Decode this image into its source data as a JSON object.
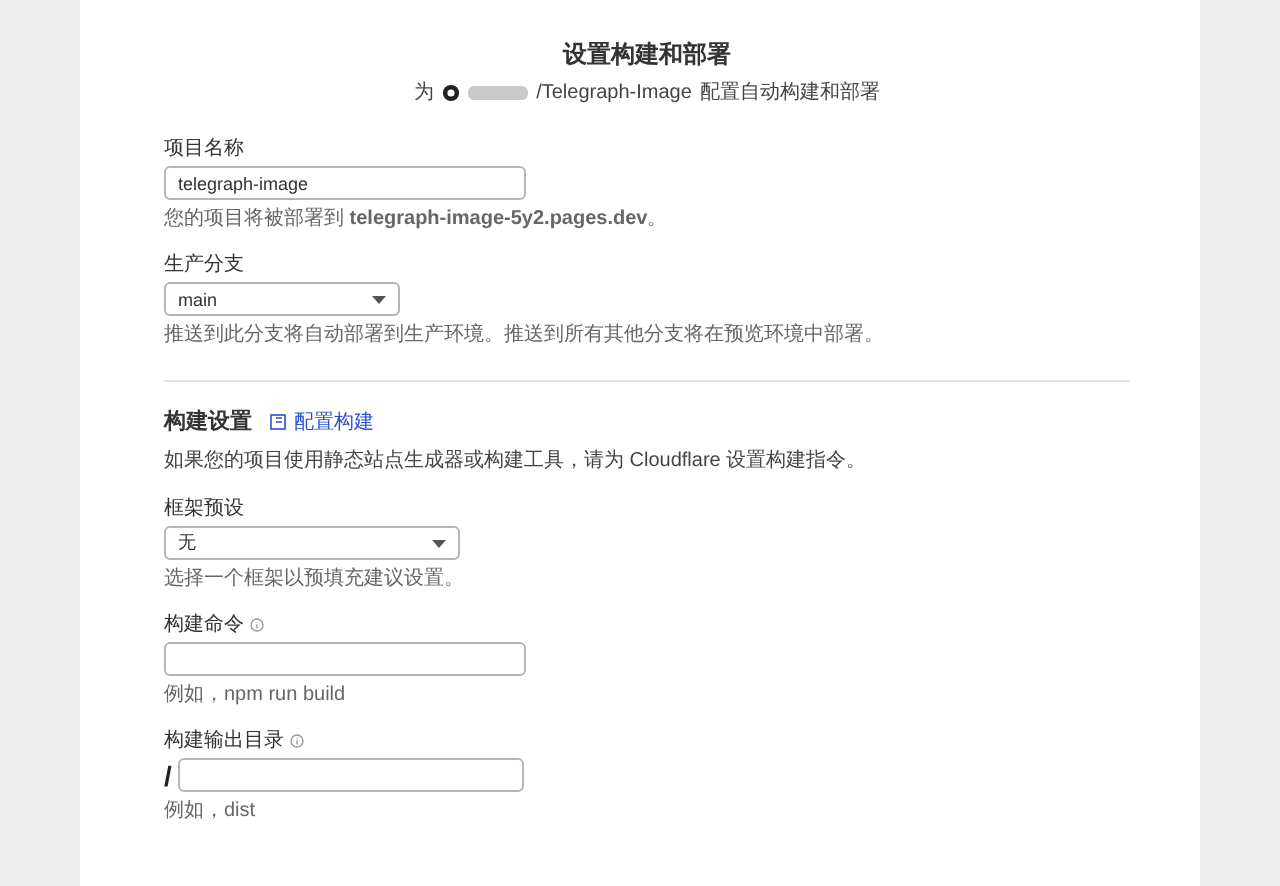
{
  "header": {
    "title": "设置构建和部署",
    "prefix": "为",
    "repo": "/Telegraph-Image",
    "suffix": "配置自动构建和部署"
  },
  "general_fields": [
    {
      "kind": "input",
      "label": "项目名称",
      "value": "telegraph-image",
      "hint": "您的项目将被部署到 **telegraph-image-5y2.pages.dev**。"
    },
    {
      "kind": "select",
      "label": "生产分支",
      "value": "main",
      "hint": "推送到此分支将自动部署到生产环境。推送到所有其他分支将在预览环境中部署。"
    }
  ],
  "build_settings": {
    "title": "构建设置",
    "link": "配置构建",
    "description": "如果您的项目使用静态站点生成器或构建工具，请为 Cloudflare 设置构建指令。",
    "fields": [
      {
        "kind": "select",
        "label": "框架预设",
        "value": "无",
        "hint": "选择一个框架以预填充建议设置。",
        "info": false
      },
      {
        "kind": "input",
        "label": "构建命令",
        "hint": "例如，npm run build",
        "info": true
      },
      {
        "kind": "path",
        "label": "构建输出目录",
        "prefix": "/",
        "hint": "例如，dist",
        "info": true
      }
    ]
  }
}
